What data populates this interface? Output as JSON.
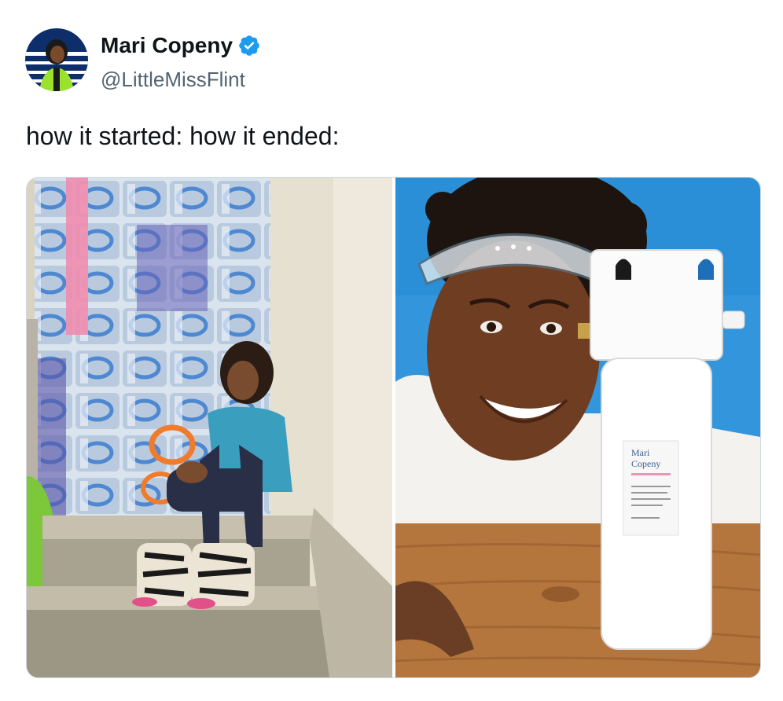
{
  "author": {
    "display_name": "Mari Copeny",
    "handle": "@LittleMissFlint",
    "verified": true,
    "verified_icon": "verified-badge-icon",
    "avatar_icon": "avatar"
  },
  "tweet": {
    "text": "how it started: how it ended:"
  },
  "media": {
    "photos": [
      {
        "alt": "Girl sitting on stairs in front of stacked cases of bottled water"
      },
      {
        "alt": "Smiling girl with safety glasses next to a white water filter on a wooden table"
      }
    ],
    "filter_label": {
      "line1": "Mari",
      "line2": "Copeny"
    }
  },
  "colors": {
    "verified_blue": "#1d9bf0",
    "handle_gray": "#536471",
    "border": "#cfd9de",
    "right_bg_blue": "#2a8fd6"
  }
}
